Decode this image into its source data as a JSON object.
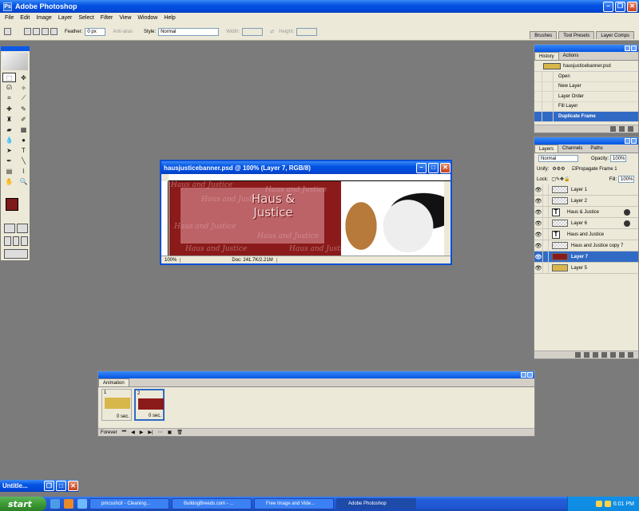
{
  "app": {
    "title": "Adobe Photoshop"
  },
  "menu": [
    "File",
    "Edit",
    "Image",
    "Layer",
    "Select",
    "Filter",
    "View",
    "Window",
    "Help"
  ],
  "options": {
    "feather_label": "Feather:",
    "feather_value": "0 px",
    "antialias": "Anti-alias",
    "style_label": "Style:",
    "style_value": "Normal",
    "width_label": "Width:",
    "height_label": "Height:"
  },
  "palette_well": [
    "Brushes",
    "Tool Presets",
    "Layer Comps"
  ],
  "document": {
    "title": "hausjusticebanner.psd @ 100% (Layer 7, RGB/8)",
    "banner_title": "Haus &\nJustice",
    "watermark": "Haus and Justice",
    "zoom": "100%",
    "doc_size": "Doc: 241.7K/2.21M"
  },
  "history": {
    "tabs": [
      "History",
      "Actions"
    ],
    "snapshot": "hausjusticebanner.psd",
    "items": [
      "Open",
      "New Layer",
      "Layer Order",
      "Fill Layer",
      "Duplicate Frame"
    ]
  },
  "layers": {
    "tabs": [
      "Layers",
      "Channels",
      "Paths"
    ],
    "blend": "Normal",
    "opacity_label": "Opacity:",
    "opacity": "100%",
    "unify_label": "Unify:",
    "propagate": "Propagate Frame 1",
    "lock_label": "Lock:",
    "fill_label": "Fill:",
    "fill": "100%",
    "items": [
      {
        "name": "Layer 1",
        "kind": "pixel"
      },
      {
        "name": "Layer 2",
        "kind": "pixel"
      },
      {
        "name": "Haus &  Justice",
        "kind": "text"
      },
      {
        "name": "Layer 6",
        "kind": "pixel"
      },
      {
        "name": "Haus and Justice",
        "kind": "text"
      },
      {
        "name": "Haus and Justice copy 7",
        "kind": "pixel"
      },
      {
        "name": "Layer 7",
        "kind": "fill"
      },
      {
        "name": "Layer 5",
        "kind": "gold"
      }
    ]
  },
  "animation": {
    "title": "Animation",
    "frames": [
      {
        "num": "1",
        "delay": "0 sec."
      },
      {
        "num": "2",
        "delay": "0 sec."
      }
    ],
    "loop": "Forever"
  },
  "minimized": {
    "title": "Untitle..."
  },
  "taskbar": {
    "start": "start",
    "tasks": [
      "pmcsshclr - Cleaning...",
      "BulldogBreeds.com - ...",
      "Free Image and Vide...",
      "Adobe Photoshop"
    ],
    "clock": "6:01 PM"
  },
  "colors": {
    "foreground": "#7e1a1a",
    "background": "#ffffff",
    "banner": "#8b1a1a",
    "selection": "#316ac5"
  }
}
